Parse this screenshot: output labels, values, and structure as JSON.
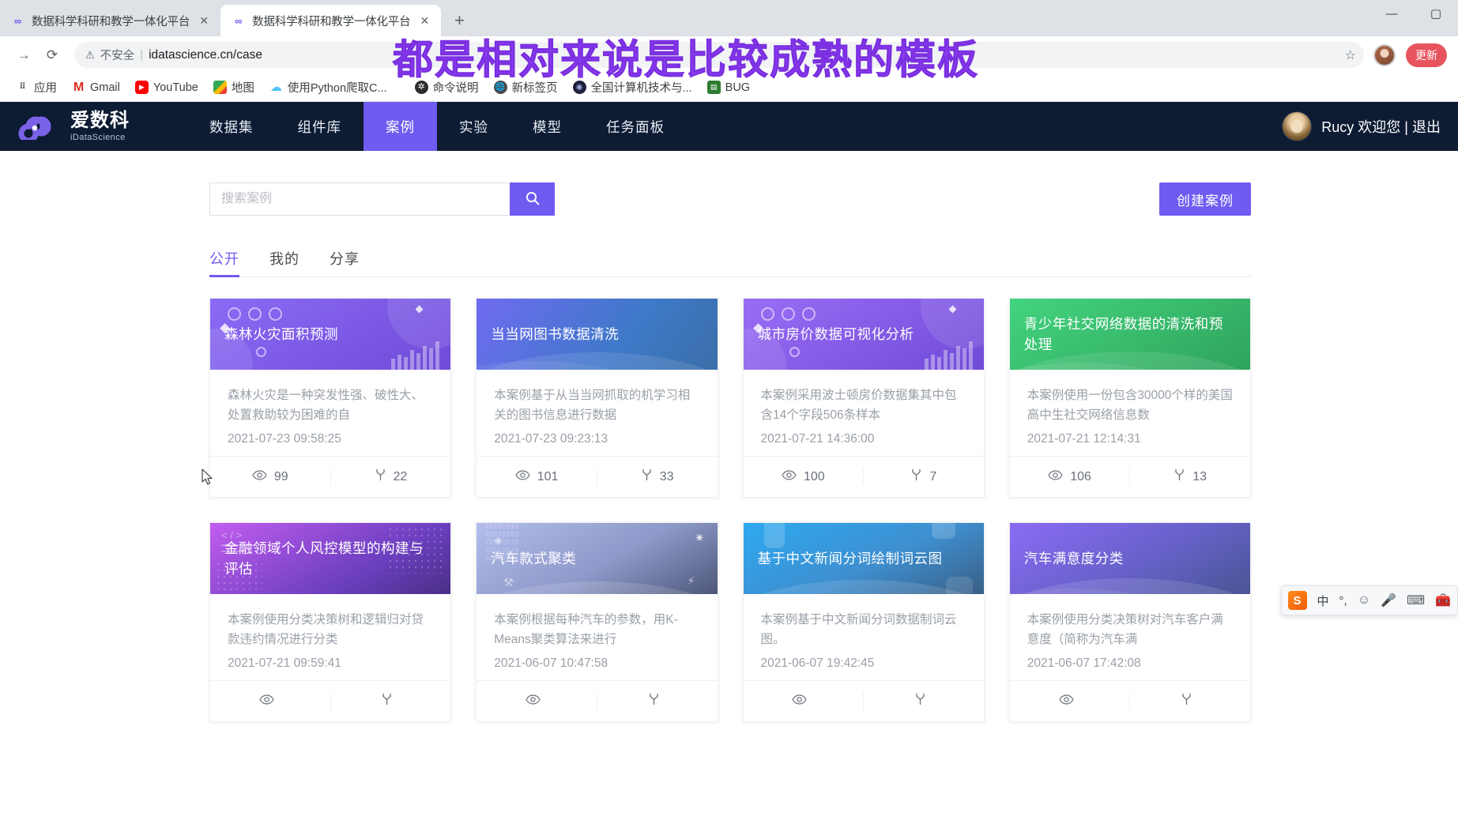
{
  "browser": {
    "tabs": [
      {
        "title": "数据科学科研和教学一体化平台",
        "favicon": "infinity-icon",
        "active": false
      },
      {
        "title": "数据科学科研和教学一体化平台",
        "favicon": "infinity-icon",
        "active": true
      }
    ],
    "new_tab_label": "+",
    "window_controls": {
      "minimize": "—",
      "maximize": "▢",
      "close": "✕"
    },
    "nav": {
      "back": "←",
      "forward": "→",
      "reload": "⟳"
    },
    "omnibox": {
      "warning_icon": "warning-triangle-icon",
      "warning_text": "不安全",
      "separator": "|",
      "url": "idatascience.cn/case",
      "star_icon": "star-icon"
    },
    "update_button_label": "更新",
    "bookmarks": [
      {
        "label": "应用",
        "icon": "apps-grid-icon"
      },
      {
        "label": "Gmail",
        "icon": "gmail-icon"
      },
      {
        "label": "YouTube",
        "icon": "youtube-icon"
      },
      {
        "label": "地图",
        "icon": "maps-icon"
      },
      {
        "label": "使用Python爬取C...",
        "icon": "cloud-icon"
      },
      {
        "label": "命令说明",
        "icon": "gear-dark-icon"
      },
      {
        "label": "新标签页",
        "icon": "globe-icon"
      },
      {
        "label": "全国计算机技术与...",
        "icon": "eye-icon"
      },
      {
        "label": "BUG",
        "icon": "bug-green-icon"
      }
    ]
  },
  "overlay_note": "都是相对来说是比较成熟的模板",
  "site": {
    "logo": {
      "cn": "爱数科",
      "en": "iDataScience",
      "mark": "infinity-logo-icon"
    },
    "nav_items": [
      {
        "label": "数据集",
        "active": false
      },
      {
        "label": "组件库",
        "active": false
      },
      {
        "label": "案例",
        "active": true
      },
      {
        "label": "实验",
        "active": false
      },
      {
        "label": "模型",
        "active": false
      },
      {
        "label": "任务面板",
        "active": false
      }
    ],
    "user": {
      "name": "Rucy 欢迎您 | 退出",
      "avatar": "user-avatar"
    },
    "search": {
      "placeholder": "搜索案例",
      "value": "",
      "button_icon": "search-icon"
    },
    "create_button_label": "创建案例",
    "segment_tabs": [
      {
        "label": "公开",
        "active": true
      },
      {
        "label": "我的",
        "active": false
      },
      {
        "label": "分享",
        "active": false
      }
    ],
    "cards": [
      {
        "title": "森林火灾面积预测",
        "desc": "森林火灾是一种突发性强、破性大、处置救助较为困难的自",
        "date": "2021-07-23 09:58:25",
        "views": "99",
        "forks": "22",
        "cover_style": "purple-rings",
        "gradient_from": "#8b6bf5",
        "gradient_to": "#6f4bd8"
      },
      {
        "title": "当当网图书数据清洗",
        "desc": "本案例基于从当当网抓取的机学习相关的图书信息进行数据",
        "date": "2021-07-23 09:23:13",
        "views": "101",
        "forks": "33",
        "cover_style": "blue-wave",
        "gradient_from": "#6f6bf0",
        "gradient_to": "#3f79c9"
      },
      {
        "title": "城市房价数据可视化分析",
        "desc": "本案例采用波士顿房价数据集其中包含14个字段506条样本",
        "date": "2021-07-21 14:36:00",
        "views": "100",
        "forks": "7",
        "cover_style": "purple-rings",
        "gradient_from": "#9a6df5",
        "gradient_to": "#6f4bd8"
      },
      {
        "title": "青少年社交网络数据的清洗和预处理",
        "desc": "本案例使用一份包含30000个样的美国高中生社交网络信息数",
        "date": "2021-07-21 12:14:31",
        "views": "106",
        "forks": "13",
        "cover_style": "green-wave",
        "gradient_from": "#3fd07a",
        "gradient_to": "#2fa35c"
      },
      {
        "title": "金融领域个人风控模型的构建与评估",
        "desc": "本案例使用分类决策树和逻辑归对贷款违约情况进行分类",
        "date": "2021-07-21 09:59:41",
        "views": "",
        "forks": "",
        "cover_style": "magenta-code",
        "gradient_from": "#c25df0",
        "gradient_to": "#5b3fa8"
      },
      {
        "title": "汽车款式聚类",
        "desc": "本案例根据每种汽车的参数，用K-Means聚类算法来进行",
        "date": "2021-06-07 10:47:58",
        "views": "",
        "forks": "",
        "cover_style": "binary-gray",
        "gradient_from": "#a9b6e8",
        "gradient_to": "#5f6a96"
      },
      {
        "title": "基于中文新闻分词绘制词云图",
        "desc": "本案例基于中文新闻分词数据制词云图。",
        "date": "2021-06-07 19:42:45",
        "views": "",
        "forks": "",
        "cover_style": "blue-square",
        "gradient_from": "#2ea9f0",
        "gradient_to": "#3a6fa8"
      },
      {
        "title": "汽车满意度分类",
        "desc": "本案例使用分类决策树对汽车客户满意度（简称为汽车满",
        "date": "2021-06-07 17:42:08",
        "views": "",
        "forks": "",
        "cover_style": "purple-wave",
        "gradient_from": "#8b6bf5",
        "gradient_to": "#4a5594"
      }
    ]
  },
  "ime": {
    "logo": "S",
    "mode": "中",
    "punct": "°,",
    "emoji_icon": "smiley-icon",
    "mic_icon": "microphone-icon",
    "keyboard_icon": "keyboard-icon",
    "menu_icon": "toolbox-icon"
  },
  "colors": {
    "accent": "#6f5bf0",
    "navbar": "#0d1b33",
    "overlay": "#8b3df0"
  }
}
